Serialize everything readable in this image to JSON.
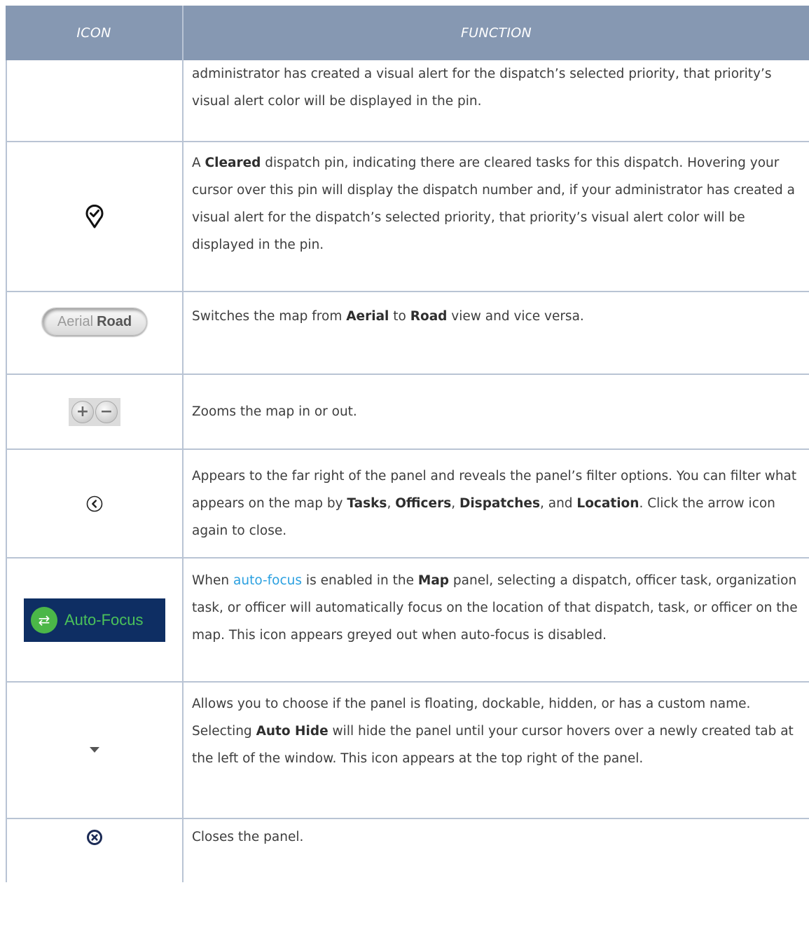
{
  "header": {
    "icon_col": "ICON",
    "function_col": "FUNCTION"
  },
  "rows": [
    {
      "icon": "",
      "segments": [
        {
          "t": "administrator has created a visual alert for the dispatch’s selected priority, that priority’s visual alert color will be displayed in the pin."
        }
      ]
    },
    {
      "icon": "cleared-pin-icon",
      "segments": [
        {
          "t": "A "
        },
        {
          "t": "Cleared",
          "b": true
        },
        {
          "t": " dispatch pin, indicating there are cleared tasks for this dispatch. Hovering your cursor over this pin will display the dispatch number and, if your administrator has created a visual alert for the dispatch’s selected priority, that priority’s visual alert color will be displayed in the pin."
        }
      ]
    },
    {
      "icon": "aerial-road-toggle",
      "icon_text": {
        "aerial": "Aerial",
        "road": "Road"
      },
      "segments": [
        {
          "t": "Switches the map from "
        },
        {
          "t": "Aerial",
          "b": true
        },
        {
          "t": " to "
        },
        {
          "t": "Road",
          "b": true
        },
        {
          "t": " view and vice versa."
        }
      ]
    },
    {
      "icon": "zoom-controls-icon",
      "icon_text": {
        "plus": "+",
        "minus": "−"
      },
      "segments": [
        {
          "t": "Zooms the map in or out."
        }
      ]
    },
    {
      "icon": "chevron-left-circle-icon",
      "segments": [
        {
          "t": "Appears to the far right of the panel and reveals the panel’s filter options. You can filter what appears on the map by "
        },
        {
          "t": "Tasks",
          "b": true
        },
        {
          "t": ", "
        },
        {
          "t": "Officers",
          "b": true
        },
        {
          "t": ", "
        },
        {
          "t": "Dispatches",
          "b": true
        },
        {
          "t": ", and "
        },
        {
          "t": "Location",
          "b": true
        },
        {
          "t": ". Click the arrow icon again to close."
        }
      ]
    },
    {
      "icon": "auto-focus-button",
      "icon_text": {
        "label": "Auto-Focus"
      },
      "segments": [
        {
          "t": "When "
        },
        {
          "t": "auto-focus",
          "link": true
        },
        {
          "t": " is enabled in the "
        },
        {
          "t": "Map",
          "b": true
        },
        {
          "t": " panel, selecting a dispatch, officer task, organization task, or officer will automatically focus on the location of that dispatch, task, or officer on the map. This icon appears greyed out when auto-focus is disabled."
        }
      ]
    },
    {
      "icon": "caret-down-icon",
      "segments": [
        {
          "t": "Allows you to choose if the panel is floating, dockable, hidden, or has a custom name. Selecting "
        },
        {
          "t": "Auto Hide",
          "b": true
        },
        {
          "t": " will hide the panel until your cursor hovers over a newly created tab at the left of the window. This icon appears at the top right of the panel."
        }
      ]
    },
    {
      "icon": "close-circle-icon",
      "segments": [
        {
          "t": "Closes the panel."
        }
      ]
    }
  ]
}
